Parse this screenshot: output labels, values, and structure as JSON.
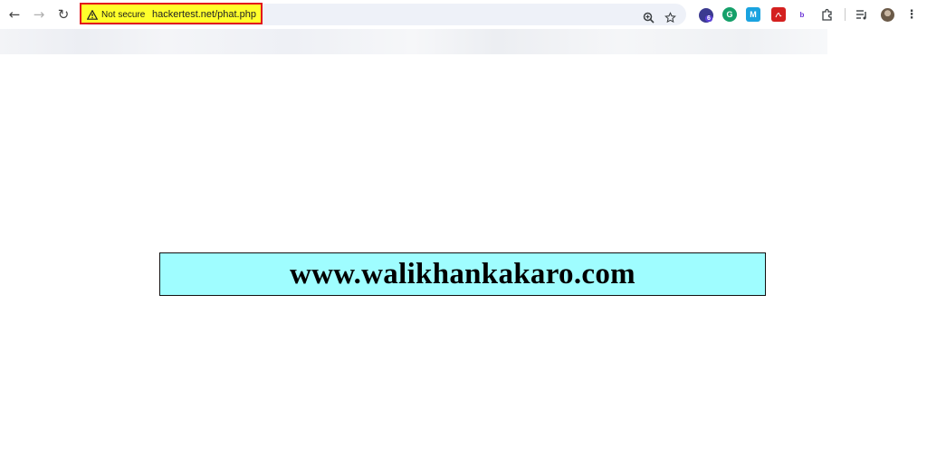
{
  "browser": {
    "security_label": "Not secure",
    "url": "hackertest.net/phat.php",
    "extension_badge": "6",
    "icons": [
      "back-icon",
      "forward-icon",
      "reload-icon",
      "warning-icon",
      "zoom-icon",
      "star-icon",
      "extension-badge-icon",
      "grammarly-icon",
      "m-extension-icon",
      "pdf-icon",
      "b-extension-icon",
      "puzzle-icon",
      "reading-list-icon",
      "profile-avatar",
      "more-menu-icon"
    ]
  },
  "page": {
    "banner_text": "www.walikhankakaro.com"
  },
  "colors": {
    "highlight": "#ffff2b",
    "highlight_border": "#e3141b",
    "banner_bg": "#9ffdff"
  }
}
